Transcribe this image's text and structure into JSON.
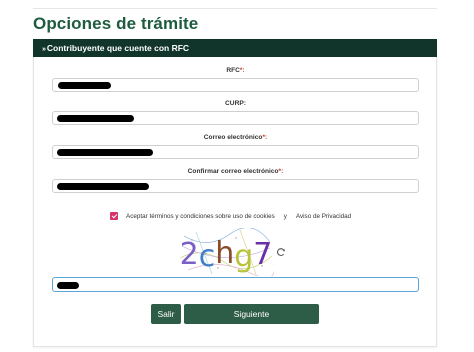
{
  "page": {
    "title": "Opciones de trámite"
  },
  "panel": {
    "header_chevron": "»",
    "header_label": "Contribuyente que cuente con RFC"
  },
  "form": {
    "rfc_label": "RFC",
    "rfc_required": "*:",
    "curp_label": "CURP:",
    "email_label": "Correo electrónico",
    "email_required": "*:",
    "confirm_email_label": "Confirmar correo electrónico",
    "confirm_email_required": "*:",
    "captcha_input_value": "[redacted]"
  },
  "terms": {
    "checked": true,
    "text": "Aceptar términos y condiciones sobre uso de cookies",
    "and": "y",
    "privacy_link": "Aviso de Privacidad"
  },
  "captcha": {
    "text": "2chg7",
    "refresh_icon": "refresh-icon"
  },
  "buttons": {
    "exit_label": "Salir",
    "next_label": "Siguiente"
  },
  "colors": {
    "title": "#1e5b3f",
    "header_bg": "#12352b",
    "button_bg": "#2d5c47",
    "checkbox": "#d6336c",
    "required": "#c0392b",
    "focus_border": "#5aa5d8"
  }
}
